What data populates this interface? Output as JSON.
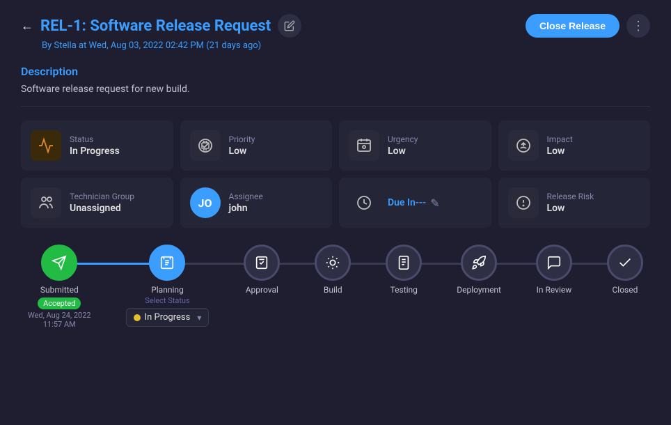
{
  "header": {
    "back_label": "←",
    "title": "REL-1: Software Release Request",
    "edit_icon": "✎",
    "subtitle_prefix": "By",
    "author": "Stella",
    "subtitle_suffix": "at Wed, Aug 03, 2022 02:42 PM (21 days ago)",
    "close_release_label": "Close Release",
    "more_icon": "⋮"
  },
  "description": {
    "section_label": "Description",
    "text": "Software release request for new build."
  },
  "info_cards": {
    "status": {
      "label": "Status",
      "value": "In Progress"
    },
    "priority": {
      "label": "Priority",
      "value": "Low"
    },
    "urgency": {
      "label": "Urgency",
      "value": "Low"
    },
    "impact": {
      "label": "Impact",
      "value": "Low"
    },
    "technician_group": {
      "label": "Technician Group",
      "value": "Unassigned"
    },
    "assignee": {
      "label": "Assignee",
      "value": "john",
      "initials": "JO"
    },
    "due": {
      "label": "Due",
      "value": "Due In---"
    },
    "release_risk": {
      "label": "Release Risk",
      "value": "Low"
    }
  },
  "timeline": {
    "nodes": [
      {
        "id": "submitted",
        "label": "Submitted",
        "badge": "Accepted",
        "date": "Wed, Aug 24, 2022\n11:57 AM",
        "type": "active"
      },
      {
        "id": "planning",
        "label": "Planning",
        "sub": "Select Status",
        "status_label": "In Progress",
        "type": "blue"
      },
      {
        "id": "approval",
        "label": "Approval",
        "type": "grey"
      },
      {
        "id": "build",
        "label": "Build",
        "type": "grey"
      },
      {
        "id": "testing",
        "label": "Testing",
        "type": "grey"
      },
      {
        "id": "deployment",
        "label": "Deployment",
        "type": "grey"
      },
      {
        "id": "in_review",
        "label": "In Review",
        "type": "grey"
      },
      {
        "id": "closed",
        "label": "Closed",
        "type": "grey"
      }
    ]
  }
}
